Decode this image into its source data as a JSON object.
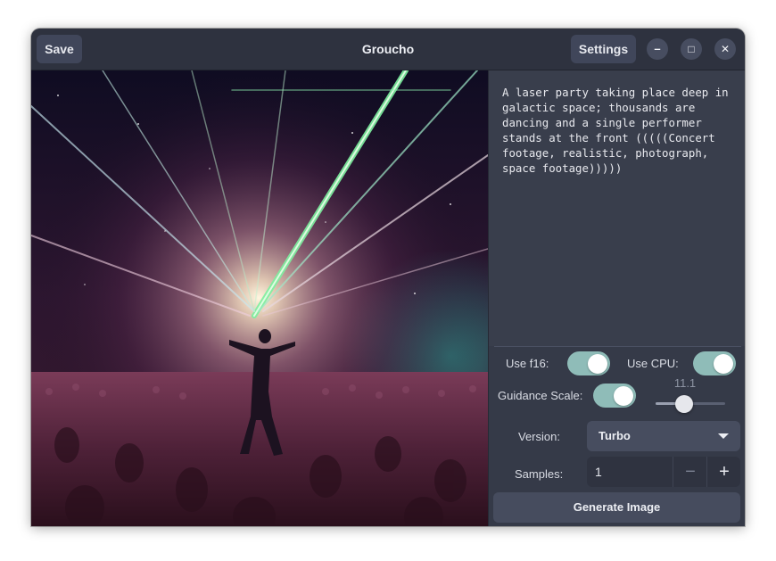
{
  "window": {
    "title": "Groucho",
    "save_label": "Save",
    "settings_label": "Settings",
    "minimize_glyph": "–",
    "maximize_glyph": "□",
    "close_glyph": "✕"
  },
  "prompt": {
    "text": "A laser party taking place deep in galactic space; thousands are dancing and a single performer stands at the front (((((Concert footage, realistic, photograph, space footage)))))"
  },
  "options": {
    "use_f16": {
      "label": "Use f16:",
      "enabled": true
    },
    "use_cpu": {
      "label": "Use CPU:",
      "enabled": true
    },
    "guidance_scale": {
      "label": "Guidance Scale:",
      "enabled": true,
      "value": "11.1",
      "value_fraction": 0.41
    },
    "version": {
      "label": "Version:",
      "selected": "Turbo"
    },
    "samples": {
      "label": "Samples:",
      "value": "1",
      "decrement_glyph": "−",
      "increment_glyph": "+"
    }
  },
  "generate_label": "Generate Image",
  "icons": {
    "minimize": "minimize-icon",
    "maximize": "maximize-icon",
    "close": "close-icon",
    "dropdown": "chevron-down-icon"
  },
  "colors": {
    "switch_on": "#8fbcb8",
    "window_bg": "#353a48",
    "headerbar_bg": "#2e323f"
  }
}
